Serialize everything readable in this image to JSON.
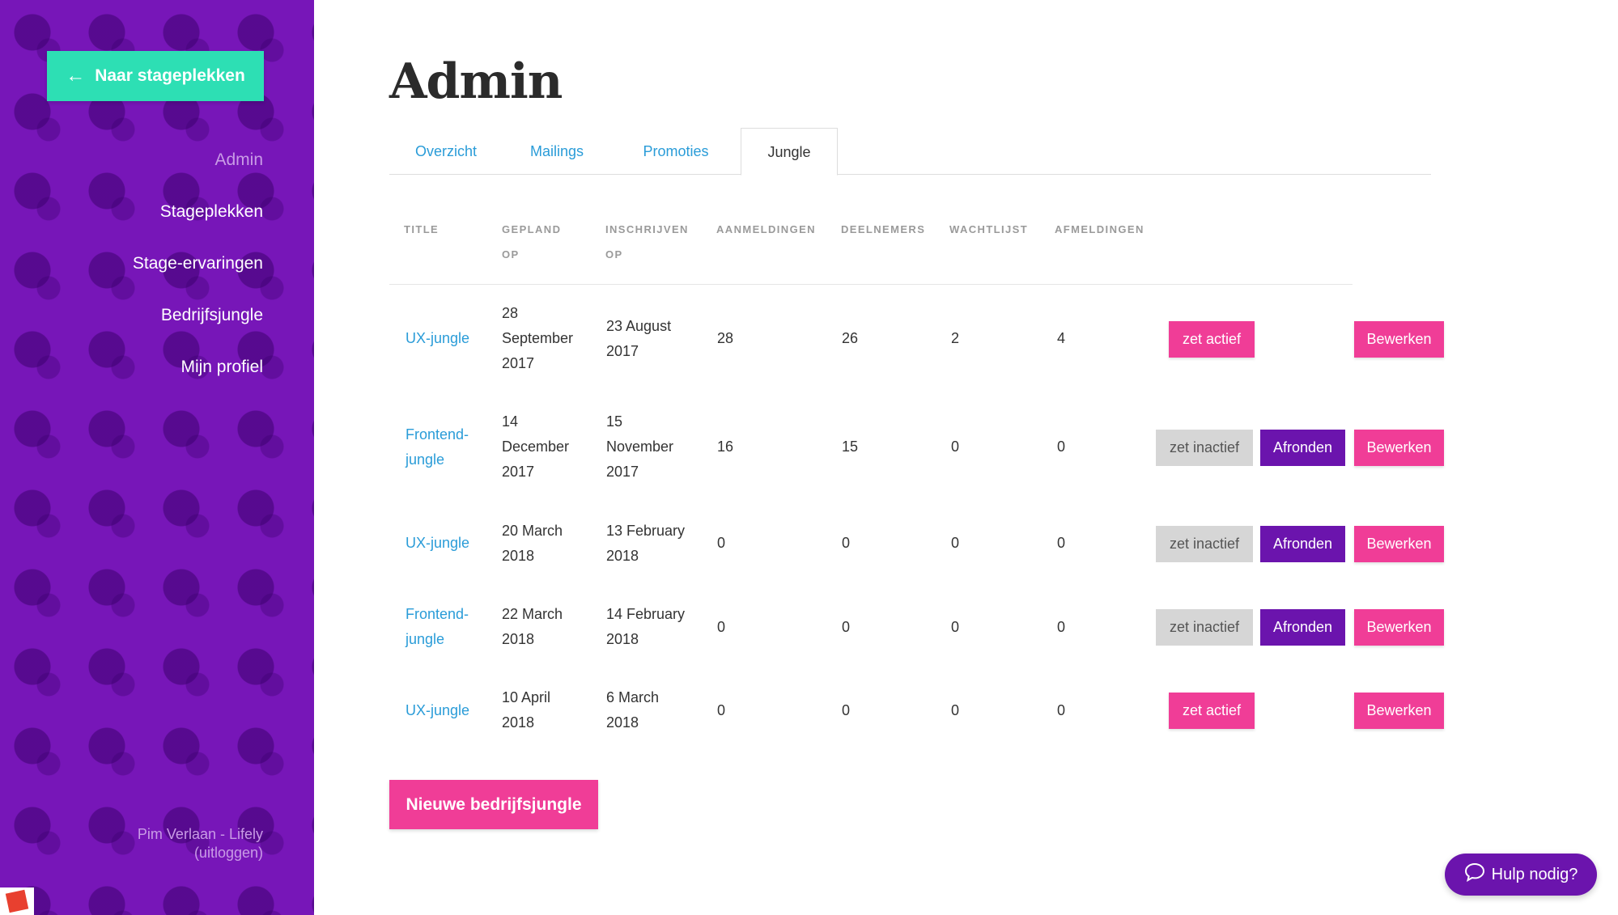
{
  "sidebar": {
    "back_label": "Naar stageplekken",
    "nav": [
      {
        "label": "Admin",
        "active": true
      },
      {
        "label": "Stageplekken"
      },
      {
        "label": "Stage-ervaringen"
      },
      {
        "label": "Bedrijfsjungle"
      },
      {
        "label": "Mijn profiel"
      }
    ],
    "user_name": "Pim Verlaan - Lifely",
    "logout": "(uitloggen)"
  },
  "page": {
    "title": "Admin",
    "tabs": [
      "Overzicht",
      "Mailings",
      "Promoties",
      "Jungle"
    ],
    "active_tab": "Jungle"
  },
  "table": {
    "headers": {
      "title": "TITLE",
      "gepland_1": "GEPLAND",
      "gepland_2": "OP",
      "inschrijven_1": "INSCHRIJVEN",
      "inschrijven_2": "OP",
      "aanmeldingen": "AANMELDINGEN",
      "deelnemers": "DEELNEMERS",
      "wachtlijst": "WACHTLIJST",
      "afmeldingen": "AFMELDINGEN"
    },
    "rows": [
      {
        "title_1": "UX-jungle",
        "title_2": "",
        "gepland_1": "28",
        "gepland_2": "September",
        "gepland_3": "2017",
        "inschrijven_1": "23 August",
        "inschrijven_2": "2017",
        "aanmeldingen": "28",
        "deelnemers": "26",
        "wachtlijst": "2",
        "afmeldingen": "4",
        "status_label": "zet actief",
        "afronden_label": "",
        "edit_label": "Bewerken"
      },
      {
        "title_1": "Frontend-",
        "title_2": "jungle",
        "gepland_1": "14",
        "gepland_2": "December",
        "gepland_3": "2017",
        "inschrijven_1": "15",
        "inschrijven_2": "November",
        "inschrijven_3": "2017",
        "aanmeldingen": "16",
        "deelnemers": "15",
        "wachtlijst": "0",
        "afmeldingen": "0",
        "status_label": "zet inactief",
        "afronden_label": "Afronden",
        "edit_label": "Bewerken"
      },
      {
        "title_1": "UX-jungle",
        "gepland_1": "20 March",
        "gepland_2": "2018",
        "inschrijven_1": "13 February",
        "inschrijven_2": "2018",
        "aanmeldingen": "0",
        "deelnemers": "0",
        "wachtlijst": "0",
        "afmeldingen": "0",
        "status_label": "zet inactief",
        "afronden_label": "Afronden",
        "edit_label": "Bewerken"
      },
      {
        "title_1": "Frontend-",
        "title_2": "jungle",
        "gepland_1": "22 March",
        "gepland_2": "2018",
        "inschrijven_1": "14 February",
        "inschrijven_2": "2018",
        "aanmeldingen": "0",
        "deelnemers": "0",
        "wachtlijst": "0",
        "afmeldingen": "0",
        "status_label": "zet inactief",
        "afronden_label": "Afronden",
        "edit_label": "Bewerken"
      },
      {
        "title_1": "UX-jungle",
        "gepland_1": "10 April",
        "gepland_2": "2018",
        "inschrijven_1": "6 March",
        "inschrijven_2": "2018",
        "aanmeldingen": "0",
        "deelnemers": "0",
        "wachtlijst": "0",
        "afmeldingen": "0",
        "status_label": "zet actief",
        "afronden_label": "",
        "edit_label": "Bewerken"
      }
    ]
  },
  "actions": {
    "new_label": "Nieuwe bedrijfsjungle",
    "help_label": "Hulp nodig?"
  },
  "colors": {
    "sidebar": "#7716b8",
    "accent_green": "#2ddfb4",
    "pink": "#f03d97",
    "purple": "#6b14ad",
    "link": "#2a9cd8"
  },
  "icons": {
    "back": "arrow-left-icon",
    "help": "chat-bubble-icon",
    "badge": "app-logo-icon"
  }
}
